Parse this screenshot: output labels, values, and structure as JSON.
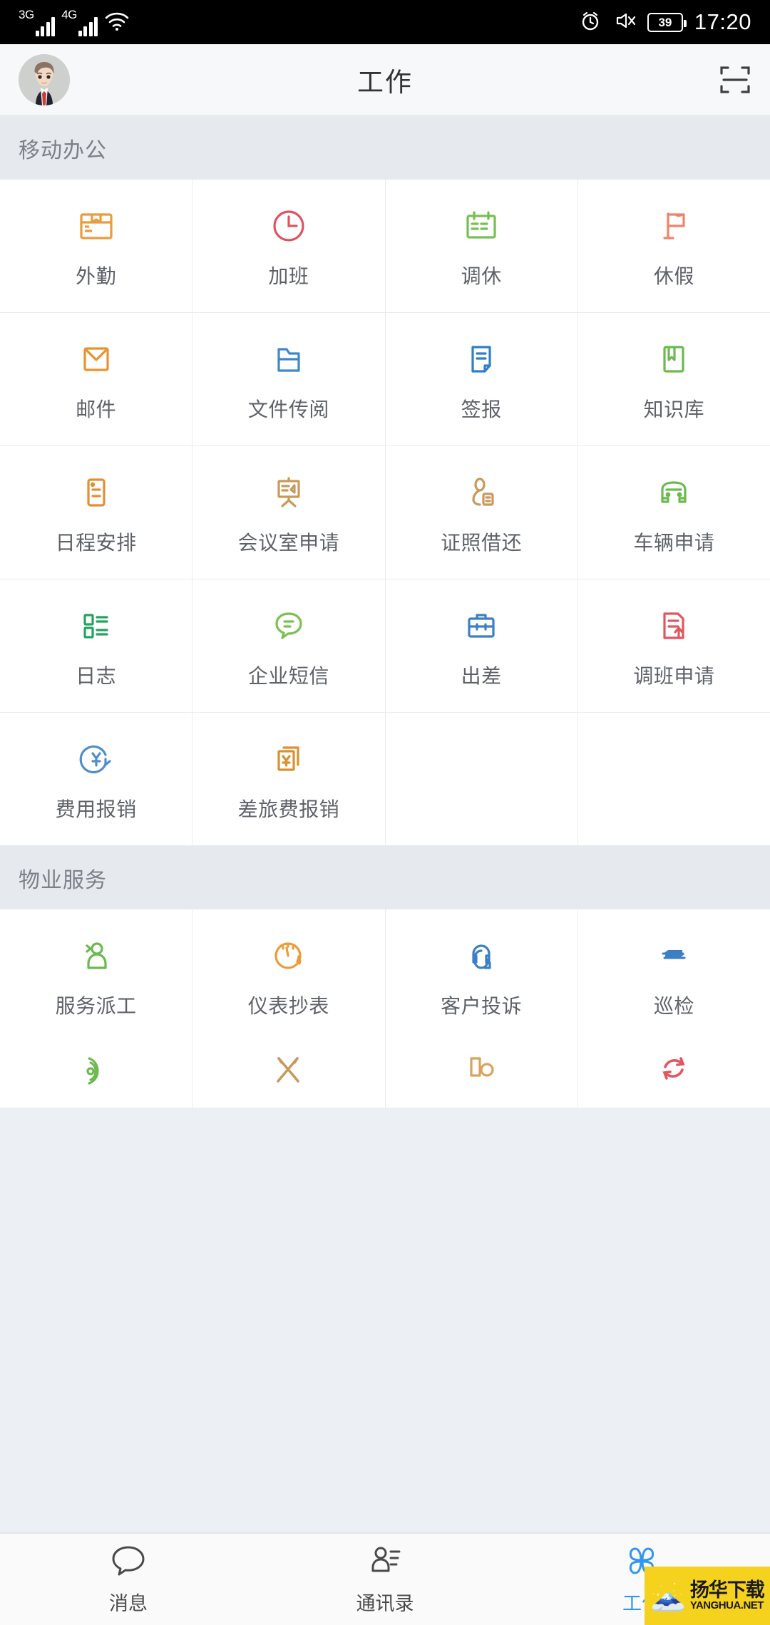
{
  "status_bar": {
    "network_1": "3G",
    "network_2": "4G",
    "wifi_icon": "wifi-icon",
    "alarm_icon": "alarm-clock-icon",
    "mute_icon": "mute-icon",
    "battery_level": "39",
    "time": "17:20"
  },
  "header": {
    "title": "工作",
    "avatar_icon": "user-avatar",
    "scan_icon": "scan-qr-icon"
  },
  "sections": [
    {
      "title": "移动办公",
      "items": [
        {
          "label": "外勤",
          "icon": "box-open-icon",
          "color": "#eb9b3b"
        },
        {
          "label": "加班",
          "icon": "clock-icon",
          "color": "#e0535e"
        },
        {
          "label": "调休",
          "icon": "calendar-icon",
          "color": "#77bf52"
        },
        {
          "label": "休假",
          "icon": "flag-icon",
          "color": "#f0826a"
        },
        {
          "label": "邮件",
          "icon": "envelope-icon",
          "color": "#e8922f"
        },
        {
          "label": "文件传阅",
          "icon": "folder-icon",
          "color": "#3d87cc"
        },
        {
          "label": "签报",
          "icon": "document-icon",
          "color": "#2e7fc6"
        },
        {
          "label": "知识库",
          "icon": "book-icon",
          "color": "#6cb950"
        },
        {
          "label": "日程安排",
          "icon": "clipboard-icon",
          "color": "#e08f33"
        },
        {
          "label": "会议室申请",
          "icon": "presentation-icon",
          "color": "#c79a5c"
        },
        {
          "label": "证照借还",
          "icon": "badge-person-icon",
          "color": "#c79a5c"
        },
        {
          "label": "车辆申请",
          "icon": "car-icon",
          "color": "#6cb950"
        },
        {
          "label": "日志",
          "icon": "list-icon",
          "color": "#22a35f"
        },
        {
          "label": "企业短信",
          "icon": "chat-bubble-icon",
          "color": "#7cc052"
        },
        {
          "label": "出差",
          "icon": "briefcase-icon",
          "color": "#3d7fc4"
        },
        {
          "label": "调班申请",
          "icon": "doc-arrow-up-icon",
          "color": "#e2565f"
        },
        {
          "label": "费用报销",
          "icon": "yen-refresh-icon",
          "color": "#4f8ec9"
        },
        {
          "label": "差旅费报销",
          "icon": "yen-receipt-icon",
          "color": "#d9902f"
        }
      ]
    },
    {
      "title": "物业服务",
      "items": [
        {
          "label": "服务派工",
          "icon": "person-dispatch-icon",
          "color": "#6cb950"
        },
        {
          "label": "仪表抄表",
          "icon": "meter-gauge-icon",
          "color": "#ee9a36"
        },
        {
          "label": "客户投诉",
          "icon": "headset-person-icon",
          "color": "#3d7fc4"
        },
        {
          "label": "巡检",
          "icon": "swap-arrows-icon",
          "color": "#3d7fc4"
        }
      ],
      "partial_items": [
        {
          "label": "",
          "icon": "sound-wave-icon",
          "color": "#6cb950"
        },
        {
          "label": "",
          "icon": "tools-icon",
          "color": "#c79a5c"
        },
        {
          "label": "",
          "icon": "folder-tag-icon",
          "color": "#d9a35e"
        },
        {
          "label": "",
          "icon": "refresh-sync-icon",
          "color": "#e2565f"
        }
      ]
    }
  ],
  "tabbar": {
    "active_color": "#3296f0",
    "tabs": [
      {
        "label": "消息",
        "icon": "message-bubble-icon",
        "active": false
      },
      {
        "label": "通讯录",
        "icon": "contacts-icon",
        "active": false
      },
      {
        "label": "工作",
        "icon": "grid-apps-icon",
        "active": true
      }
    ]
  },
  "watermark": {
    "line1": "扬华下载",
    "line2": "YANGHUA.NET"
  }
}
